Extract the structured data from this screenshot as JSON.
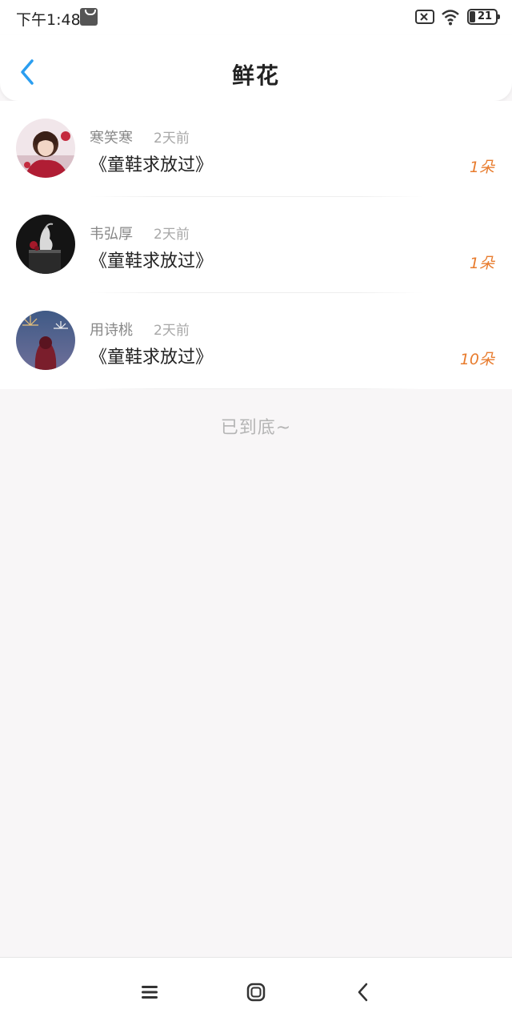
{
  "status_bar": {
    "time": "下午1:48",
    "battery": "21"
  },
  "header": {
    "title": "鲜花",
    "back_icon": "chevron-left-icon"
  },
  "items": [
    {
      "username": "寒笑寒",
      "time": "2天前",
      "book": "《童鞋求放过》",
      "count": "1朵"
    },
    {
      "username": "韦弘厚",
      "time": "2天前",
      "book": "《童鞋求放过》",
      "count": "1朵"
    },
    {
      "username": "用诗桃",
      "time": "2天前",
      "book": "《童鞋求放过》",
      "count": "10朵"
    }
  ],
  "end_text": "已到底~",
  "colors": {
    "accent": "#2b9ef0",
    "count": "#e87c2e"
  },
  "nav_bar": {
    "menu_icon": "menu-icon",
    "home_icon": "home-icon",
    "back_icon": "back-icon"
  }
}
